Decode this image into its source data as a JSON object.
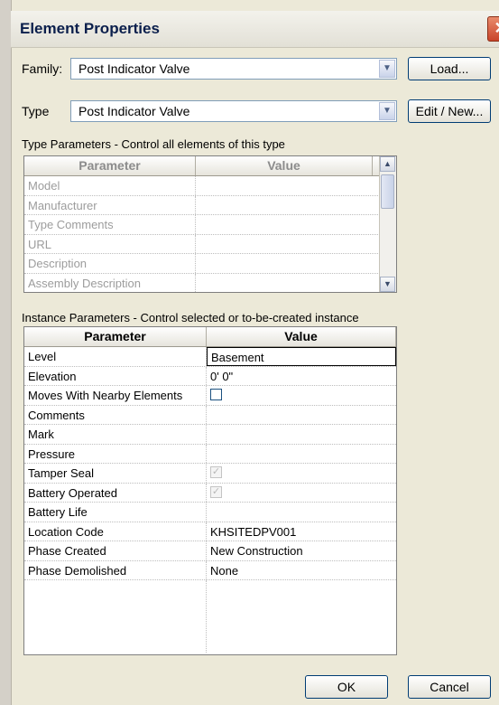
{
  "window": {
    "title": "Element Properties",
    "close_symbol": "✕"
  },
  "family": {
    "label": "Family:",
    "value": "Post Indicator Valve",
    "button": "Load..."
  },
  "type": {
    "label": "Type",
    "value": "Post Indicator Valve",
    "button": "Edit / New..."
  },
  "type_params": {
    "caption": "Type Parameters - Control all elements of this type",
    "headers": {
      "parameter": "Parameter",
      "value": "Value"
    },
    "rows": [
      {
        "p": "Model",
        "v": ""
      },
      {
        "p": "Manufacturer",
        "v": ""
      },
      {
        "p": "Type Comments",
        "v": ""
      },
      {
        "p": "URL",
        "v": ""
      },
      {
        "p": "Description",
        "v": ""
      },
      {
        "p": "Assembly Description",
        "v": ""
      }
    ]
  },
  "instance_params": {
    "caption": "Instance Parameters - Control selected or to-be-created instance",
    "headers": {
      "parameter": "Parameter",
      "value": "Value"
    },
    "rows": [
      {
        "p": "Level",
        "v": "Basement"
      },
      {
        "p": "Elevation",
        "v": "0'  0\""
      },
      {
        "p": "Moves With Nearby Elements",
        "v": ""
      },
      {
        "p": "Comments",
        "v": ""
      },
      {
        "p": "Mark",
        "v": ""
      },
      {
        "p": "Pressure",
        "v": ""
      },
      {
        "p": "Tamper Seal",
        "v": ""
      },
      {
        "p": "Battery Operated",
        "v": ""
      },
      {
        "p": "Battery Life",
        "v": ""
      },
      {
        "p": "Location Code",
        "v": "KHSITEDPV001"
      },
      {
        "p": "Phase Created",
        "v": "New Construction"
      },
      {
        "p": "Phase Demolished",
        "v": "None"
      }
    ],
    "moves_with_nearby_checked": false,
    "tamper_seal_checked": true,
    "battery_operated_checked": true
  },
  "footer": {
    "ok": "OK",
    "cancel": "Cancel"
  },
  "icons": {
    "dropdown": "chevron-down-icon",
    "scroll_up": "scroll-up-icon",
    "scroll_down": "scroll-down-icon",
    "check": "checkmark-icon"
  }
}
